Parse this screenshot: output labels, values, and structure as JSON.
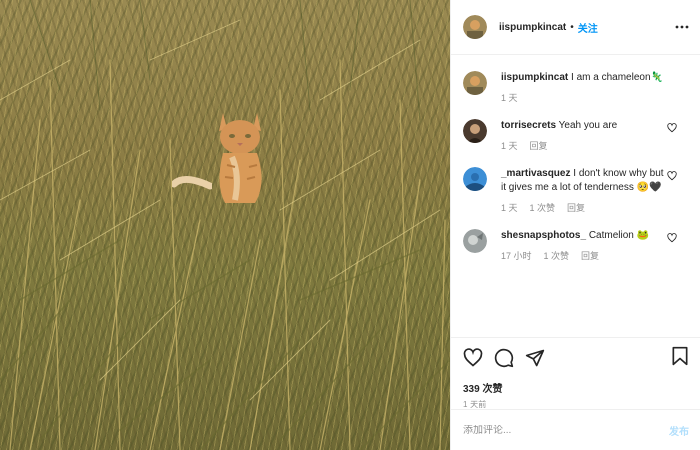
{
  "post": {
    "author": "iispumpkincat",
    "follow_label": "关注",
    "separator": "•",
    "caption": {
      "username": "iispumpkincat",
      "text": "I am a chameleon",
      "emoji": "🦎",
      "time": "1 天"
    }
  },
  "comments": [
    {
      "username": "torrisecrets",
      "text": "Yeah you are",
      "time": "1 天",
      "reply_label": "回复",
      "avatar_color": "#4a3a2e"
    },
    {
      "username": "_martivasquez",
      "text": "I don't know why but it gives me a lot of tenderness 🥺🖤",
      "time": "1 天",
      "likes": "1 次赞",
      "reply_label": "回复",
      "avatar_color": "#3d8fd6"
    },
    {
      "username": "shesnapsphotos_",
      "text": "Catmelion 🐸",
      "time": "17 小时",
      "likes": "1 次赞",
      "reply_label": "回复",
      "avatar_color": "#9aa0a0"
    }
  ],
  "engagement": {
    "likes": "339 次赞",
    "posted": "1 天前"
  },
  "comment_box": {
    "placeholder": "添加评论...",
    "post_label": "发布"
  },
  "icons": [
    "more-icon",
    "heart-icon",
    "comment-icon",
    "share-icon",
    "bookmark-icon"
  ]
}
